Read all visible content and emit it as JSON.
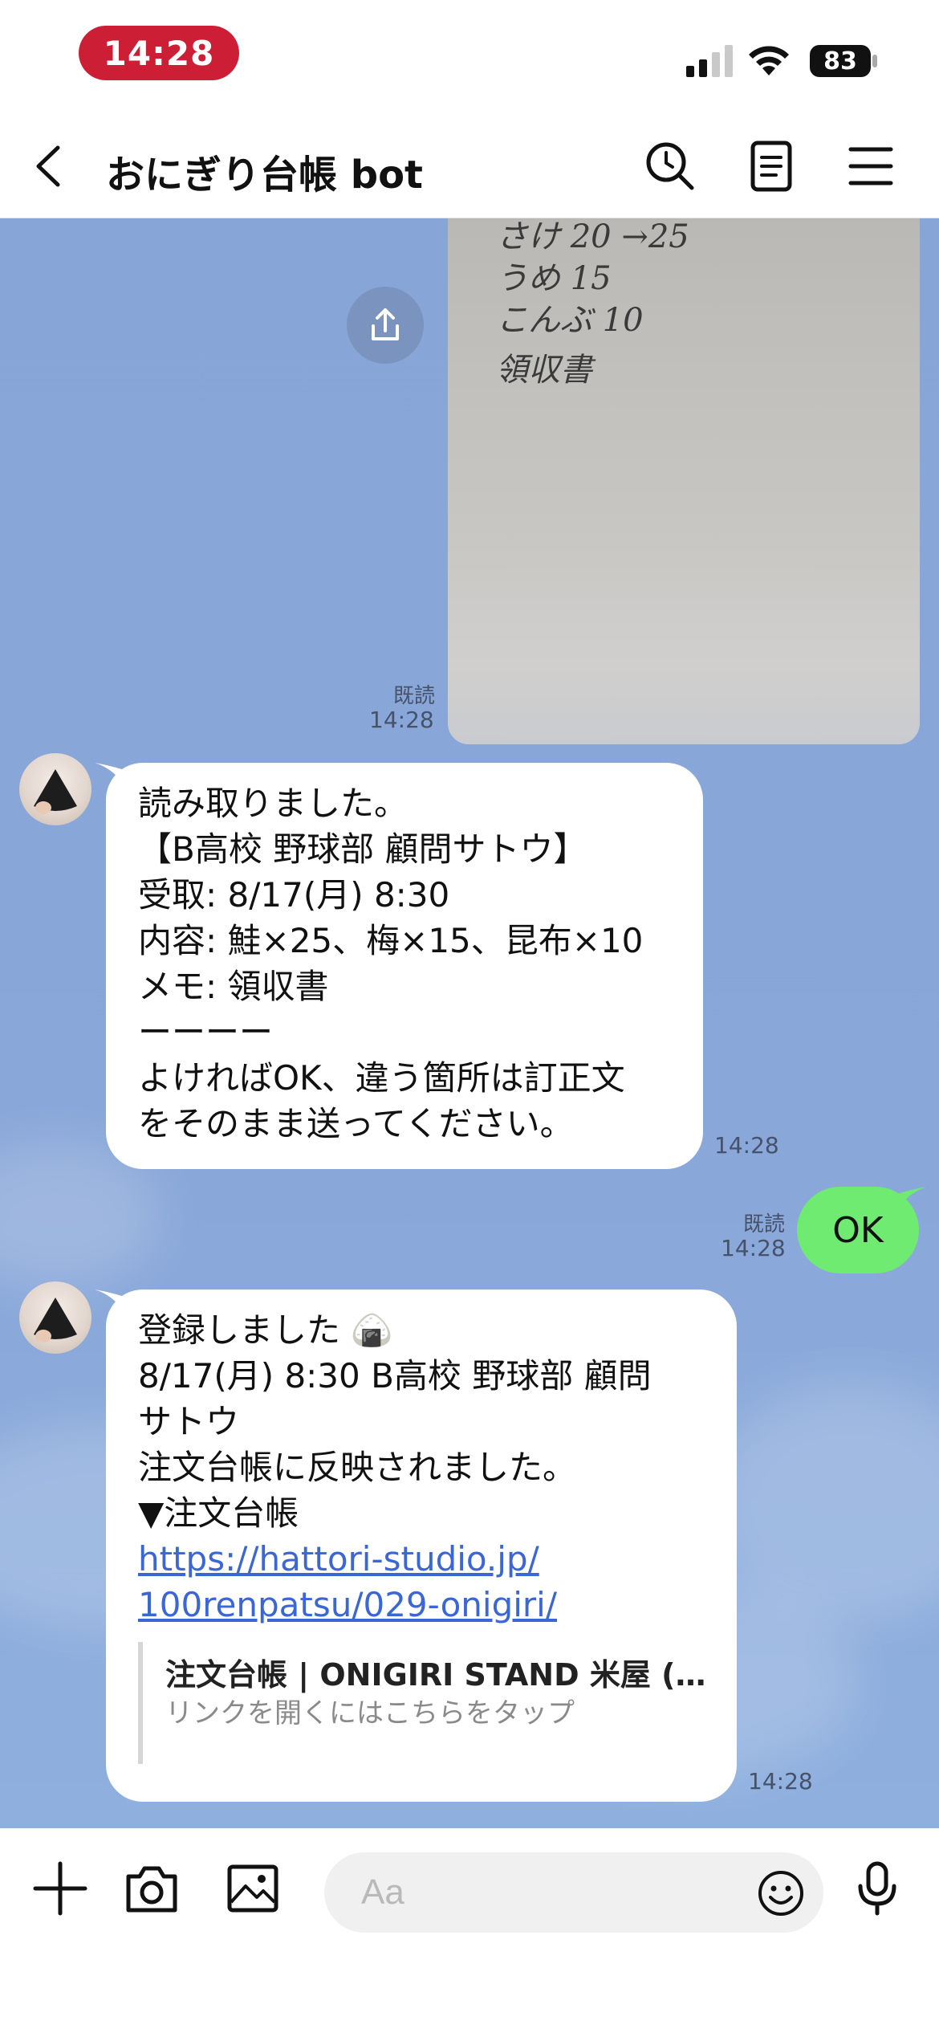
{
  "status_bar": {
    "time": "14:28",
    "battery": "83",
    "icons": [
      "cellular-signal-icon",
      "wifi-icon",
      "battery-icon"
    ]
  },
  "header": {
    "title": "おにぎり台帳 bot",
    "icons": [
      "back-chevron-icon",
      "search-icon",
      "notes-icon",
      "menu-icon"
    ]
  },
  "photo_message": {
    "handwritten_lines": [
      "さけ 20 →25",
      "うめ 15",
      "こんぶ 10",
      "領収書"
    ],
    "read_label": "既読",
    "time": "14:28"
  },
  "bot_message_1": {
    "lines": [
      "読み取りました。",
      "【B高校 野球部 顧問サトウ】",
      "受取: 8/17(月) 8:30",
      "内容: 鮭×25、梅×15、昆布×10",
      "メモ: 領収書",
      "ーーーー",
      "よければOK、違う箇所は訂正文",
      "をそのまま送ってください。"
    ],
    "time": "14:28"
  },
  "user_message": {
    "text": "OK",
    "read_label": "既読",
    "time": "14:28"
  },
  "bot_message_2": {
    "lines": [
      "登録しました 🍙",
      "8/17(月) 8:30 B高校 野球部 顧問",
      "サトウ",
      "注文台帳に反映されました。",
      "▼注文台帳"
    ],
    "link_lines": [
      "https://hattori-studio.jp/",
      "100renpatsu/029-onigiri/"
    ],
    "preview_title": "注文台帳 | ONIGIRI STAND 米屋 (…",
    "preview_subtitle": "リンクを開くにはこちらをタップ",
    "time": "14:28"
  },
  "input_bar": {
    "placeholder": "Aa",
    "icons": [
      "plus-icon",
      "camera-icon",
      "image-icon",
      "emoji-icon",
      "microphone-icon"
    ]
  },
  "colors": {
    "chat_background": "#88a5d8",
    "user_bubble": "#6eeb70",
    "time_pill": "#cc1f35",
    "link": "#3a66d6"
  }
}
